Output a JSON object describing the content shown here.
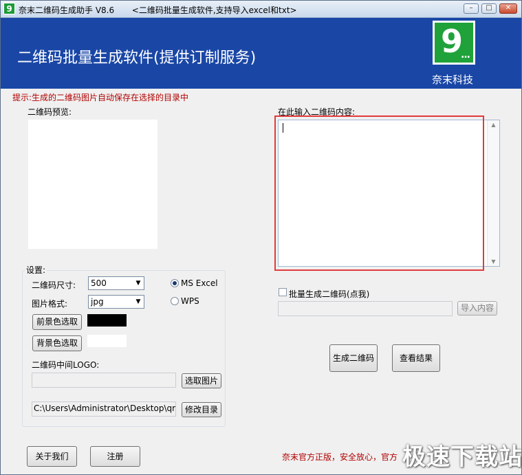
{
  "window": {
    "app_title": "奈末二维码生成助手 V8.6",
    "subtitle": "<二维码批量生成软件,支持导入excel和txt>"
  },
  "banner": {
    "title": "二维码批量生成软件(提供订制服务)",
    "company": "奈末科技",
    "logo_text": "9",
    "logo_dots": "..."
  },
  "hint": "提示:生成的二维码图片自动保存在选择的目录中",
  "preview": {
    "label": "二维码预览:"
  },
  "settings": {
    "title": "设置:",
    "size_label": "二维码尺寸:",
    "size_value": "500",
    "format_label": "图片格式:",
    "format_value": "jpg",
    "radio_excel": "MS  Excel",
    "radio_wps": "WPS",
    "fg_button": "前景色选取",
    "bg_button": "背景色选取",
    "fg_color": "#000000",
    "bg_color": "#ffffff",
    "logo_label": "二维码中间LOGO:",
    "logo_path": "",
    "pick_image_button": "选取图片",
    "dir_path": "C:\\Users\\Administrator\\Desktop\\qrcod",
    "change_dir_button": "修改目录"
  },
  "input": {
    "label": "在此输入二维码内容:",
    "value": ""
  },
  "batch": {
    "checkbox_label": "批量生成二维码(点我)",
    "import_path": "",
    "import_button": "导入内容"
  },
  "actions": {
    "generate_button": "生成二维码",
    "view_button": "查看结果",
    "about_button": "关于我们",
    "register_button": "注册"
  },
  "footer": {
    "text": "奈末官方正版，安全放心，官方",
    "watermark": "极速下载站"
  },
  "colors": {
    "banner": "#1a47a6",
    "hint_red": "#b10000",
    "frame_red": "#e23a3a",
    "logo_green": "#1fa23a"
  }
}
